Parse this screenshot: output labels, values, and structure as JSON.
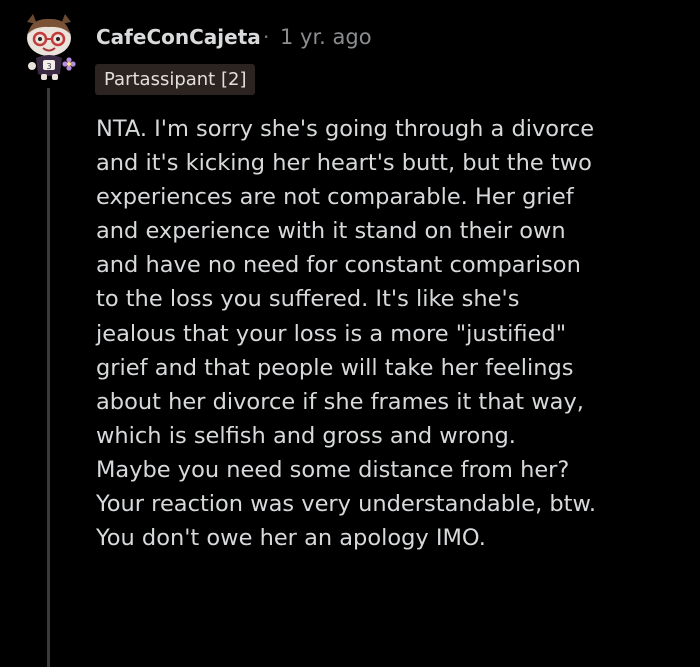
{
  "comment": {
    "author": "CafeConCajeta",
    "separator": "·",
    "time_ago": "1 yr. ago",
    "flair": "Partassipant [2]",
    "avatar_icon": "snoo-avatar-icon",
    "lines": [
      "NTA. I'm sorry she's going through a divorce",
      "and it's kicking her heart's butt, but the two",
      "experiences are not comparable. Her grief",
      "and experience with it stand on their own",
      "and have no need for constant comparison",
      "to the loss you suffered. It's like she's",
      "jealous that your loss is a more \"justified\"",
      "grief and that people will take her feelings",
      "about her divorce if she frames it that way,",
      "which is selfish and gross and wrong.",
      "Maybe you need some distance from her?",
      "Your reaction was very understandable, btw.",
      "You don't owe her an apology IMO."
    ]
  },
  "colors": {
    "background": "#000000",
    "text": "#d7d9db",
    "username": "#d9dadb",
    "meta": "#8b8d8f",
    "flair_bg": "#2c2420",
    "thread_line": "#3a3a3a"
  }
}
